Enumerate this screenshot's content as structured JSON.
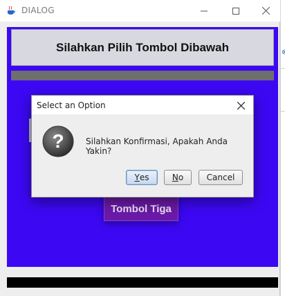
{
  "window": {
    "title": "DIALOG",
    "app_icon": "java-cup-icon",
    "controls": [
      "minimize-icon",
      "maximize-icon",
      "close-icon"
    ]
  },
  "panel": {
    "heading": "Silahkan Pilih Tombol Dibawah",
    "button_tiga": "Tombol Tiga",
    "colors": {
      "panel_bg": "#3c08f4",
      "header_bg": "#d8d9e0",
      "button_bg": "#6b1aa8",
      "gray_bar": "#6e6e6e",
      "black_bar": "#000000"
    }
  },
  "dialog": {
    "title": "Select an Option",
    "message": "Silahkan Konfirmasi, Apakah Anda Yakin?",
    "icon": "question-icon",
    "buttons": {
      "yes": {
        "mnemonic": "Y",
        "rest": "es"
      },
      "no": {
        "mnemonic": "N",
        "rest": "o"
      },
      "cancel": "Cancel"
    }
  }
}
